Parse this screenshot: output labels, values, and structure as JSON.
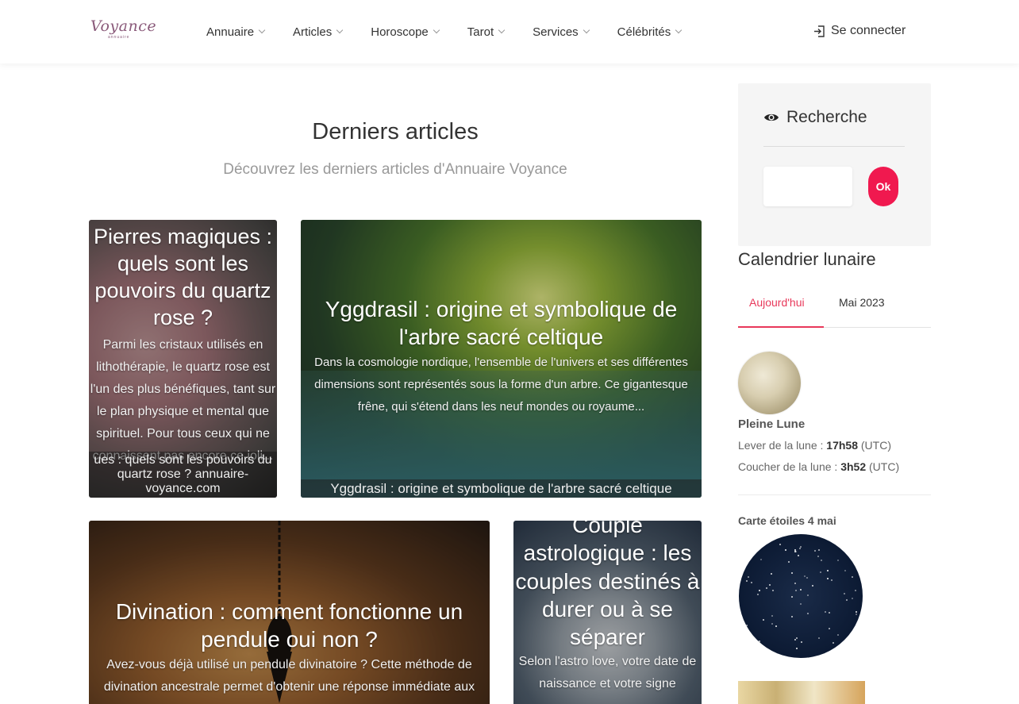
{
  "header": {
    "logo_text": "Voyance",
    "logo_sub": "annuaire",
    "nav": [
      {
        "label": "Annuaire"
      },
      {
        "label": "Articles"
      },
      {
        "label": "Horoscope"
      },
      {
        "label": "Tarot"
      },
      {
        "label": "Services"
      },
      {
        "label": "Célébrités"
      }
    ],
    "login_label": "Se connecter"
  },
  "main": {
    "title": "Derniers articles",
    "subtitle": "Découvrez les derniers articles d'Annuaire Voyance",
    "cards": [
      {
        "title": "Pierres magiques : quels sont les pouvoirs du quartz rose ?",
        "excerpt": "Parmi les cristaux utilisés en lithothérapie, le quartz rose est l'un des plus bénéfiques, tant sur le plan physique et mental que spirituel. Pour tous ceux qui ne connaissent pas encore ce joli...",
        "caption": "ues : quels sont les pouvoirs du quartz rose ? annuaire-voyance.com"
      },
      {
        "title": "Yggdrasil : origine et symbolique de l'arbre sacré celtique",
        "excerpt": "Dans la cosmologie nordique, l'ensemble de l'univers et ses différentes dimensions sont représentés sous la forme d'un arbre. Ce gigantesque frêne, qui s'étend dans les neuf mondes ou royaume...",
        "caption": "Yggdrasil : origine et symbolique de l'arbre sacré celtique"
      },
      {
        "title": "Divination : comment fonctionne un pendule oui non ?",
        "excerpt": "Avez-vous déjà utilisé un pendule divinatoire ? Cette méthode de divination ancestrale permet d'obtenir une réponse immédiate aux"
      },
      {
        "title": "Couple astrologique : les couples destinés à durer ou à se séparer",
        "excerpt": "Selon l'astro love, votre date de naissance et votre signe"
      }
    ]
  },
  "sidebar": {
    "search": {
      "title": "Recherche",
      "button": "Ok",
      "value": ""
    },
    "lunar": {
      "title": "Calendrier lunaire",
      "tabs": [
        "Aujourd'hui",
        "Mai 2023"
      ],
      "phase": "Pleine Lune",
      "rise_label": "Lever de la lune : ",
      "rise_time": "17h58",
      "rise_tz": " (UTC)",
      "set_label": "Coucher de la lune : ",
      "set_time": "3h52",
      "set_tz": " (UTC)"
    },
    "stars": {
      "title": "Carte étoiles 4 mai"
    }
  },
  "colors": {
    "accent": "#e8385a",
    "ok_button": "#f0194f"
  },
  "icons": {
    "login": "login-icon",
    "search": "eye-icon",
    "chevron": "chevron-down-icon"
  }
}
